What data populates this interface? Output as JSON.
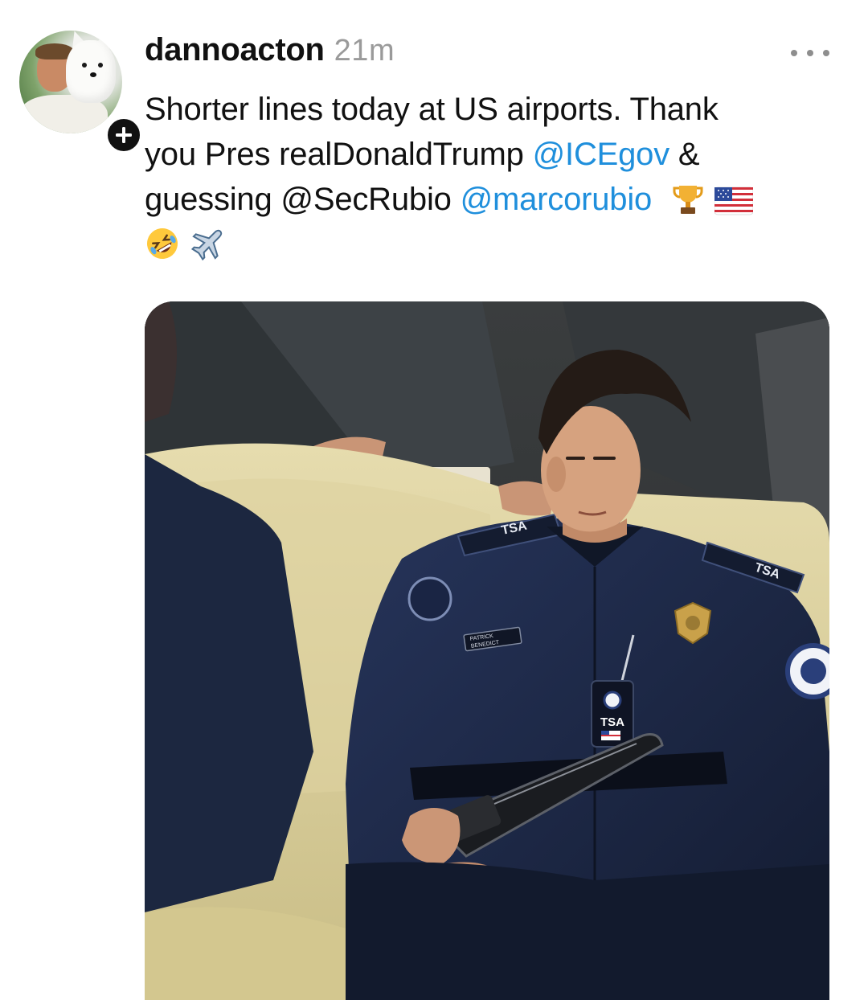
{
  "post": {
    "username": "dannoacton",
    "timestamp": "21m",
    "text_line_1": "Shorter lines today at US airports. Thank",
    "text_line_2a": "you Pres realDonaldTrump ",
    "mention_1": "@ICEgov",
    "text_line_2b": " &",
    "text_line_3a": "guessing @SecRubio ",
    "mention_2": "@marcorubio",
    "emoji_names": [
      "trophy-icon",
      "us-flag-icon",
      "rolling-laughing-icon",
      "airplane-icon"
    ]
  },
  "media": {
    "patch_label_left": "TSA",
    "patch_label_right": "TSA",
    "badge_text": "TSA",
    "nametag_line1": "PATRICK",
    "nametag_line2": "BENEDICT"
  },
  "colors": {
    "mention": "#1f8fdc",
    "timestamp": "#9a9a9a",
    "uniform": "#1d2a45",
    "couch": "#d9cf9e"
  }
}
